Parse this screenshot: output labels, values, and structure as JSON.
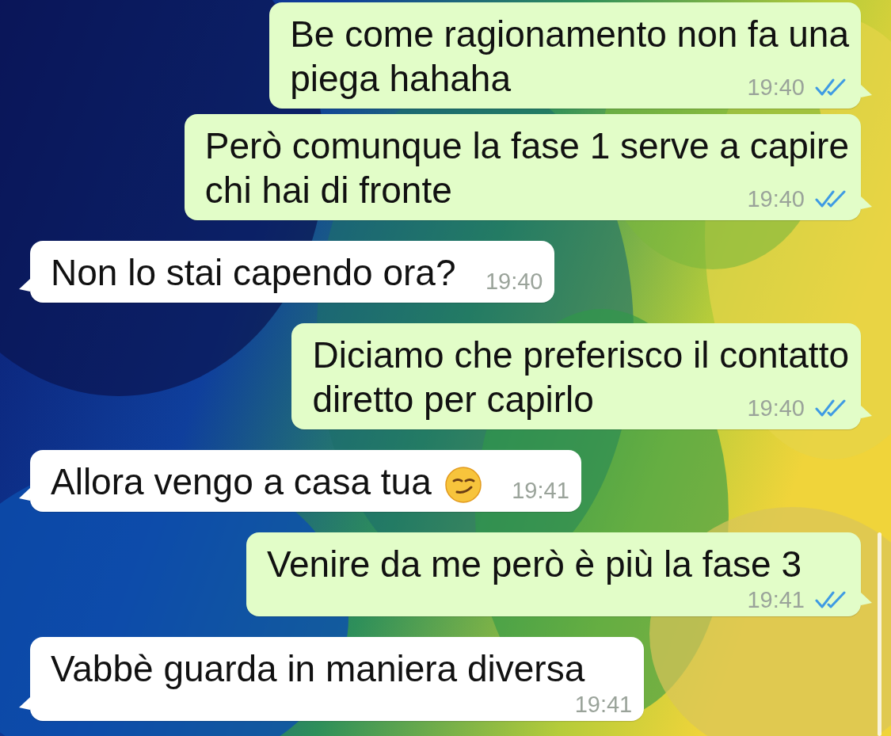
{
  "messages": [
    {
      "sent": true,
      "kind": "inline",
      "lines": [
        "Be come ragionamento non fa una",
        "piega hahaha"
      ],
      "time": "19:40",
      "read": true
    },
    {
      "sent": true,
      "kind": "inline",
      "lines": [
        "Però comunque la fase 1 serve a capire",
        "chi hai di fronte"
      ],
      "time": "19:40",
      "read": true
    },
    {
      "sent": false,
      "kind": "inline",
      "lines": [
        "Non lo stai capendo ora?"
      ],
      "time": "19:40"
    },
    {
      "sent": true,
      "kind": "inline",
      "lines": [
        "Diciamo che preferisco il contatto",
        "diretto per capirlo"
      ],
      "time": "19:40",
      "read": true
    },
    {
      "sent": false,
      "kind": "inline",
      "lines": [
        "Allora vengo a casa tua"
      ],
      "emoji": {
        "kind": "smirk"
      },
      "time": "19:41"
    },
    {
      "sent": true,
      "kind": "stacked",
      "lines": [
        "Venire da me però è più la fase 3"
      ],
      "time": "19:41",
      "read": true
    },
    {
      "sent": false,
      "kind": "stacked",
      "lines": [
        "Vabbè guarda in maniera diversa"
      ],
      "time": "19:41"
    }
  ]
}
